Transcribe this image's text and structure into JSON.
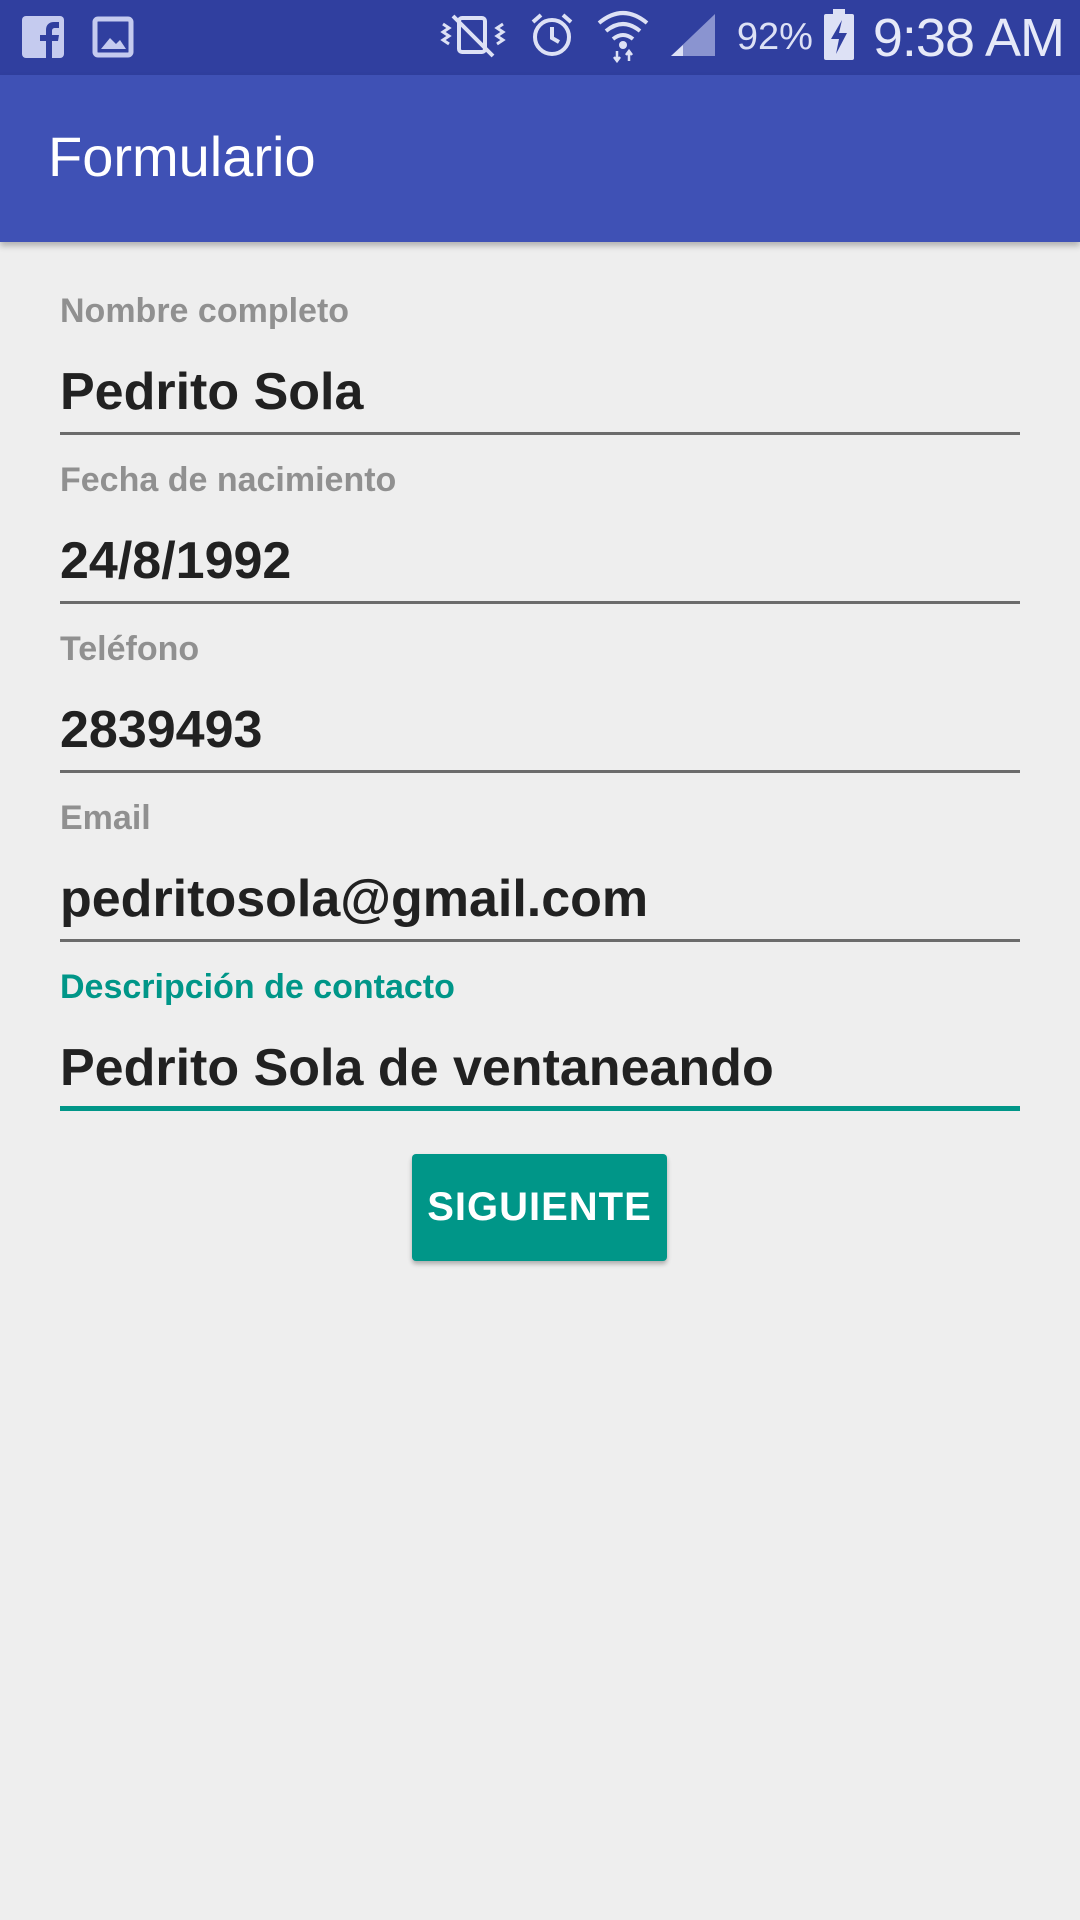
{
  "status_bar": {
    "battery_percent": "92%",
    "time": "9:38 AM",
    "icons_left": [
      "facebook-icon",
      "gallery-icon"
    ],
    "icons_right": [
      "vibrate-mute-icon",
      "alarm-icon",
      "wifi-icon",
      "signal-icon",
      "battery-charging-icon"
    ]
  },
  "app_bar": {
    "title": "Formulario",
    "color": "#3f51b5"
  },
  "form": {
    "fields": [
      {
        "label": "Nombre completo",
        "value": "Pedrito Sola"
      },
      {
        "label": "Fecha de nacimiento",
        "value": "24/8/1992"
      },
      {
        "label": "Teléfono",
        "value": "2839493"
      },
      {
        "label": "Email",
        "value": "pedritosola@gmail.com"
      },
      {
        "label": "Descripción de contacto",
        "value": "Pedrito Sola de ventaneando"
      }
    ],
    "accent_color": "#009688"
  },
  "next_button": {
    "label": "SIGUIENTE"
  }
}
